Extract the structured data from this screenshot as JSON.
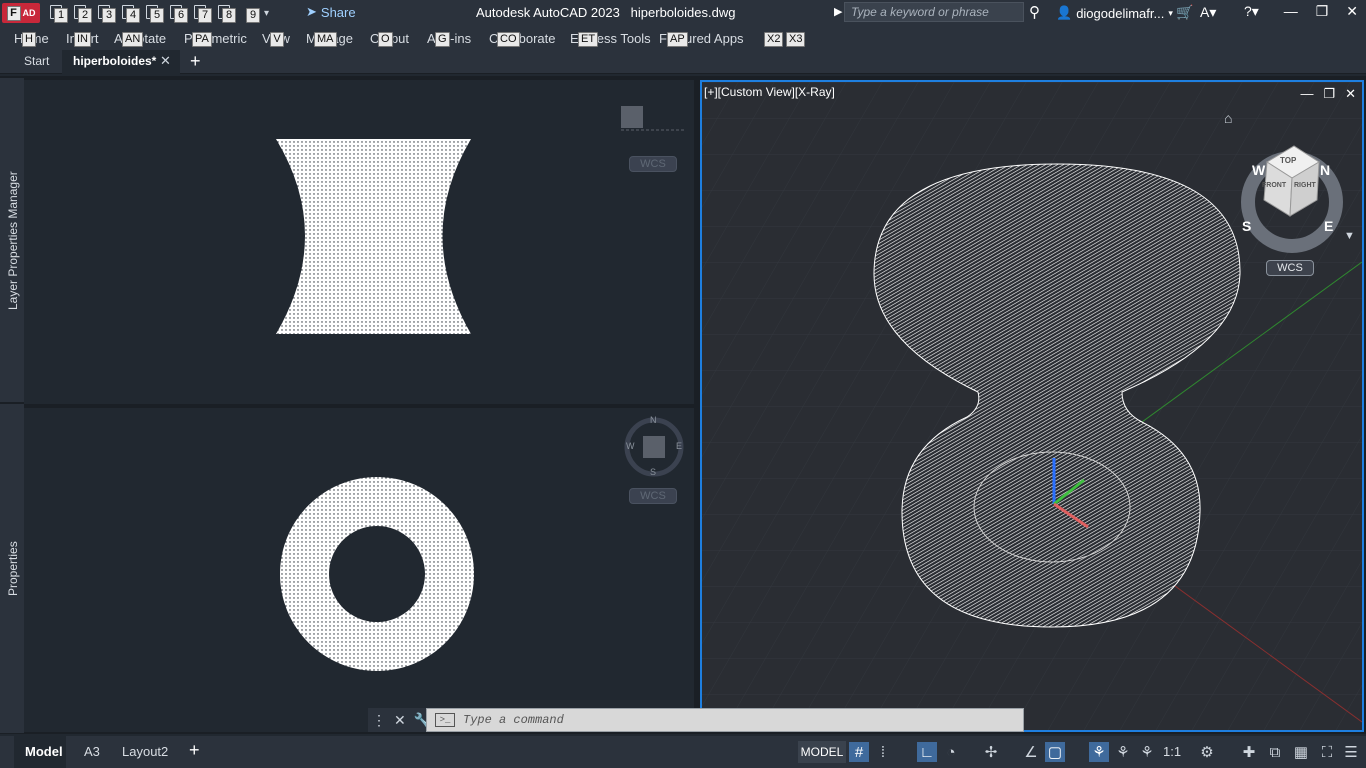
{
  "app": {
    "logo_letters": "A",
    "logo_tip": "F",
    "logo_tip2": "AD",
    "title": "Autodesk AutoCAD 2023",
    "filename": "hiperboloides.dwg"
  },
  "qat_tips": [
    "1",
    "2",
    "3",
    "4",
    "5",
    "6",
    "7",
    "8",
    "9"
  ],
  "share_label": "Share",
  "search_placeholder": "Type a keyword or phrase",
  "user_name": "diogodelimafr...",
  "menu": [
    {
      "label": "Home",
      "tip": "H"
    },
    {
      "label": "Insert",
      "tip": "IN"
    },
    {
      "label": "Annotate",
      "tip": "AN"
    },
    {
      "label": "Parametric",
      "tip": "PA"
    },
    {
      "label": "View",
      "tip": "V"
    },
    {
      "label": "Manage",
      "tip": "MA"
    },
    {
      "label": "Output",
      "tip": "O"
    },
    {
      "label": "Add-ins",
      "tip": "G"
    },
    {
      "label": "Collaborate",
      "tip": "CO"
    },
    {
      "label": "Express Tools",
      "tip": "ET"
    },
    {
      "label": "Featured Apps",
      "tip": "AP"
    }
  ],
  "menu_extra_tips": [
    "X2",
    "X3"
  ],
  "doc_tabs": {
    "start": "Start",
    "active": "hiperboloides*"
  },
  "palettes": {
    "top": "Layer Properties Manager",
    "bottom": "Properties"
  },
  "viewports": {
    "right_label": "[+][Custom View][X-Ray]",
    "wcs": "WCS",
    "compass": {
      "n": "N",
      "s": "S",
      "e": "E",
      "w": "W"
    },
    "viewcube": {
      "top": "TOP",
      "front": "FRONT",
      "right": "RIGHT"
    }
  },
  "command": {
    "placeholder": "Type a command"
  },
  "layout_tabs": [
    "Model",
    "A3",
    "Layout2"
  ],
  "status": {
    "model": "MODEL",
    "scale": "1:1"
  }
}
